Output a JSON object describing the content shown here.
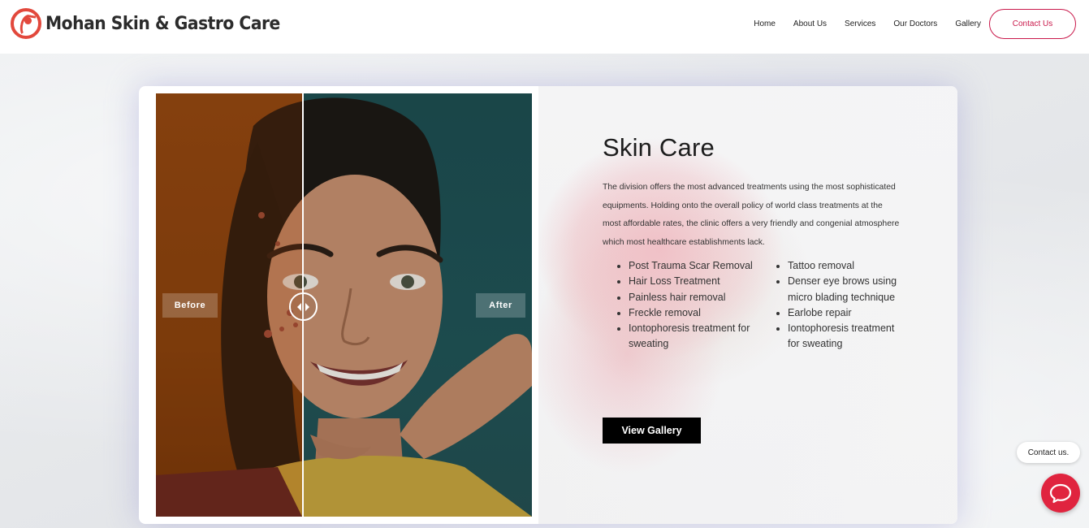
{
  "header": {
    "logo_text": "Mohan Skin & Gastro Care",
    "nav": [
      "Home",
      "About Us",
      "Services",
      "Our Doctors",
      "Gallery"
    ],
    "contact_button": "Contact Us"
  },
  "compare": {
    "before_label": "Before",
    "after_label": "After"
  },
  "section": {
    "title": "Skin Care",
    "description": "The division offers the most advanced treatments using the most sophisticated equipments. Holding onto the overall policy of world class treatments at the most affordable rates, the clinic offers a very friendly and congenial atmosphere which most healthcare establishments lack.",
    "list_left": [
      "Post Trauma Scar Removal",
      "Hair Loss Treatment",
      "Painless hair removal",
      "Freckle removal",
      "Iontophoresis treatment for sweating"
    ],
    "list_right": [
      "Tattoo removal",
      "Denser eye brows using micro blading technique",
      "Earlobe repair",
      "Iontophoresis treatment for sweating"
    ],
    "gallery_button": "View Gallery"
  },
  "widget": {
    "contact_bubble": "Contact us."
  },
  "colors": {
    "brand_red": "#e2483c",
    "accent": "#c9184a",
    "chat": "#e0243f"
  }
}
